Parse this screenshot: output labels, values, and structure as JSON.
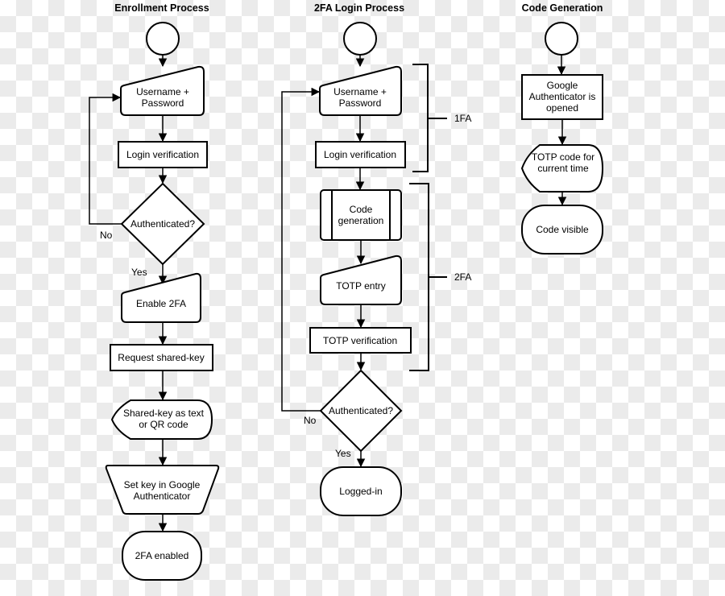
{
  "columns": [
    {
      "title": "Enrollment Process",
      "nodes": {
        "credentials": [
          "Username +",
          "Password"
        ],
        "login_verification": "Login verification",
        "authenticated": "Authenticated?",
        "enable_2fa": "Enable 2FA",
        "request_key": "Request shared-key",
        "shared_key": [
          "Shared-key as text",
          "or QR code"
        ],
        "set_key": [
          "Set key in Google",
          "Authenticator"
        ],
        "end": "2FA enabled"
      },
      "edges": {
        "no": "No",
        "yes": "Yes"
      }
    },
    {
      "title": "2FA Login Process",
      "nodes": {
        "credentials": [
          "Username +",
          "Password"
        ],
        "login_verification": "Login verification",
        "code_generation": [
          "Code",
          "generation"
        ],
        "totp_entry": "TOTP entry",
        "totp_verification": "TOTP verification",
        "authenticated": "Authenticated?",
        "end": "Logged-in"
      },
      "edges": {
        "no": "No",
        "yes": "Yes"
      },
      "brackets": [
        "1FA",
        "2FA"
      ]
    },
    {
      "title": "Code Generation",
      "nodes": {
        "opened": [
          "Google",
          "Authenticator is",
          "opened"
        ],
        "totp_code": [
          "TOTP code for",
          "current time"
        ],
        "end": "Code visible"
      }
    }
  ]
}
